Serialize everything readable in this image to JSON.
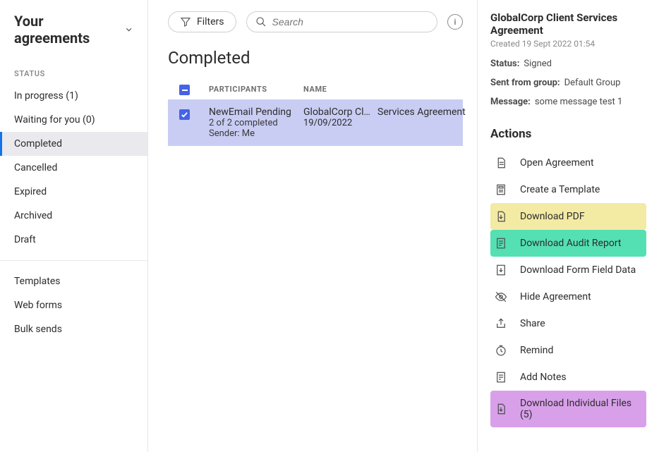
{
  "page_title": "Your agreements",
  "sidebar": {
    "status_label": "STATUS",
    "items": [
      {
        "label": "In progress (1)"
      },
      {
        "label": "Waiting for you (0)"
      },
      {
        "label": "Completed",
        "active": true
      },
      {
        "label": "Cancelled"
      },
      {
        "label": "Expired"
      },
      {
        "label": "Archived"
      },
      {
        "label": "Draft"
      }
    ],
    "secondary": [
      {
        "label": "Templates"
      },
      {
        "label": "Web forms"
      },
      {
        "label": "Bulk sends"
      }
    ]
  },
  "toolbar": {
    "filters_label": "Filters",
    "search_placeholder": "Search"
  },
  "section_heading": "Completed",
  "columns": {
    "participants": "PARTICIPANTS",
    "name": "NAME"
  },
  "rows": [
    {
      "participant_line1": "NewEmail Pending",
      "participant_line2": "2 of 2 completed",
      "participant_line3": "Sender: Me",
      "name_part1": "GlobalCorp Cli…",
      "name_part2": "Services Agreement",
      "date": "19/09/2022"
    }
  ],
  "detail": {
    "title": "GlobalCorp Client Services Agreement",
    "created": "Created 19 Sept 2022 01:54",
    "status_k": "Status:",
    "status_v": "Signed",
    "group_k": "Sent from group:",
    "group_v": "Default Group",
    "message_k": "Message:",
    "message_v": "some message test 1",
    "actions_head": "Actions",
    "actions": {
      "open": "Open Agreement",
      "template": "Create a Template",
      "pdf": "Download PDF",
      "audit": "Download Audit Report",
      "formdata": "Download Form Field Data",
      "hide": "Hide Agreement",
      "share": "Share",
      "remind": "Remind",
      "notes": "Add Notes",
      "individual": "Download Individual Files (5)"
    }
  }
}
